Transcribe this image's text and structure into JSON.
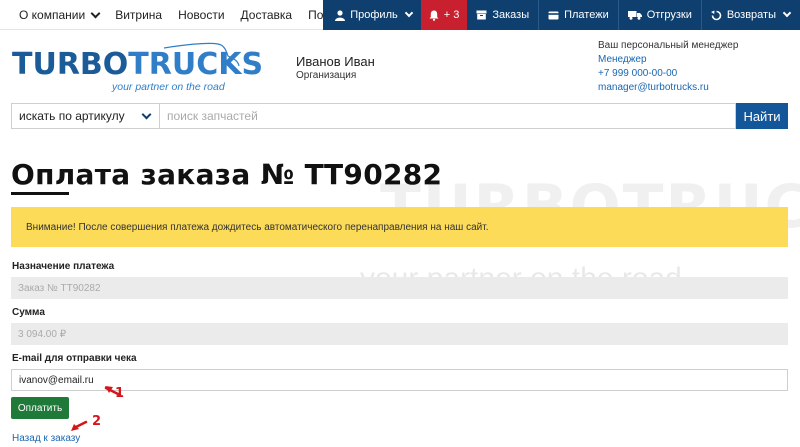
{
  "topnav": {
    "left": [
      {
        "label": "О компании",
        "has_dropdown": true
      },
      {
        "label": "Витрина"
      },
      {
        "label": "Новости"
      },
      {
        "label": "Доставка"
      },
      {
        "label": "Помощь"
      }
    ],
    "profile": "Профиль",
    "notifications": "+ 3",
    "orders": "Заказы",
    "payments": "Платежи",
    "shipments": "Отгрузки",
    "returns": "Возвраты",
    "colors": {
      "dark": "#0e3f6e",
      "alert": "#c8202f"
    }
  },
  "logo": {
    "part1": "TURBO",
    "part2": "TRUCKS",
    "tagline": "your partner on the road"
  },
  "user": {
    "name": "Иванов Иван",
    "org": "Организация"
  },
  "manager": {
    "title": "Ваш персональный менеджер",
    "name": "Менеджер",
    "phone": "+7 999 000-00-00",
    "email": "manager@turbotrucks.ru"
  },
  "search": {
    "mode": "искать по артикулу",
    "placeholder": "поиск запчастей",
    "value": "",
    "button": "Найти"
  },
  "watermark": {
    "text": "TURBOTRUCKS",
    "tagline": "your partner on the road"
  },
  "page": {
    "title": "Оплата заказа № ТТ90282",
    "warning": "Внимание! После совершения платежа дождитесь автоматического перенаправления на наш сайт.",
    "purpose_label": "Назначение платежа",
    "purpose_value": "Заказ № ТТ90282",
    "amount_label": "Сумма",
    "amount_value": "3 094.00 ₽",
    "email_label": "E-mail для отправки чека",
    "email_value": "ivanov@email.ru",
    "pay_button": "Оплатить",
    "back_link": "Назад к заказу"
  },
  "annotations": [
    {
      "number": "1"
    },
    {
      "number": "2"
    }
  ]
}
